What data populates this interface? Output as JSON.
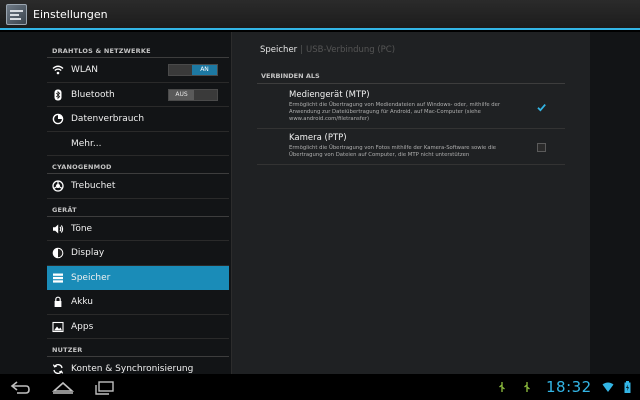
{
  "actionbar": {
    "title": "Einstellungen",
    "icon": "settings-app-icon"
  },
  "sidebar": {
    "sections": [
      {
        "header": "DRAHTLOS & NETZWERKE",
        "items": [
          {
            "label": "WLAN",
            "icon": "wifi-icon",
            "toggle": "AN"
          },
          {
            "label": "Bluetooth",
            "icon": "bluetooth-icon",
            "toggle": "AUS"
          },
          {
            "label": "Datenverbrauch",
            "icon": "data-usage-icon"
          },
          {
            "label": "Mehr..."
          }
        ]
      },
      {
        "header": "CYANOGENMOD",
        "items": [
          {
            "label": "Trebuchet",
            "icon": "launcher-icon"
          }
        ]
      },
      {
        "header": "GERÄT",
        "items": [
          {
            "label": "Töne",
            "icon": "speaker-icon"
          },
          {
            "label": "Display",
            "icon": "brightness-icon"
          },
          {
            "label": "Speicher",
            "icon": "storage-icon",
            "selected": true
          },
          {
            "label": "Akku",
            "icon": "battery-icon"
          },
          {
            "label": "Apps",
            "icon": "apps-icon"
          }
        ]
      },
      {
        "header": "NUTZER",
        "items": [
          {
            "label": "Konten & Synchronisierung",
            "icon": "sync-icon"
          }
        ]
      }
    ]
  },
  "detail": {
    "breadcrumb": [
      "Speicher",
      "USB-Verbindung (PC)"
    ],
    "section_header": "VERBINDEN ALS",
    "options": [
      {
        "title": "Mediengerät (MTP)",
        "description": "Ermöglicht die Übertragung von Mediendateien auf Windows- oder, mithilfe der Anwendung zur Dateiübertragung für Android, auf Mac-Computer (siehe www.android.com/filetransfer)",
        "checked": true
      },
      {
        "title": "Kamera (PTP)",
        "description": "Ermöglicht die Übertragung von Fotos mithilfe der Kamera-Software sowie die Übertragung von Dateien auf Computer, die MTP nicht unterstützen",
        "checked": false
      }
    ]
  },
  "systembar": {
    "clock": "18:32",
    "accent": "#33b5e5"
  }
}
